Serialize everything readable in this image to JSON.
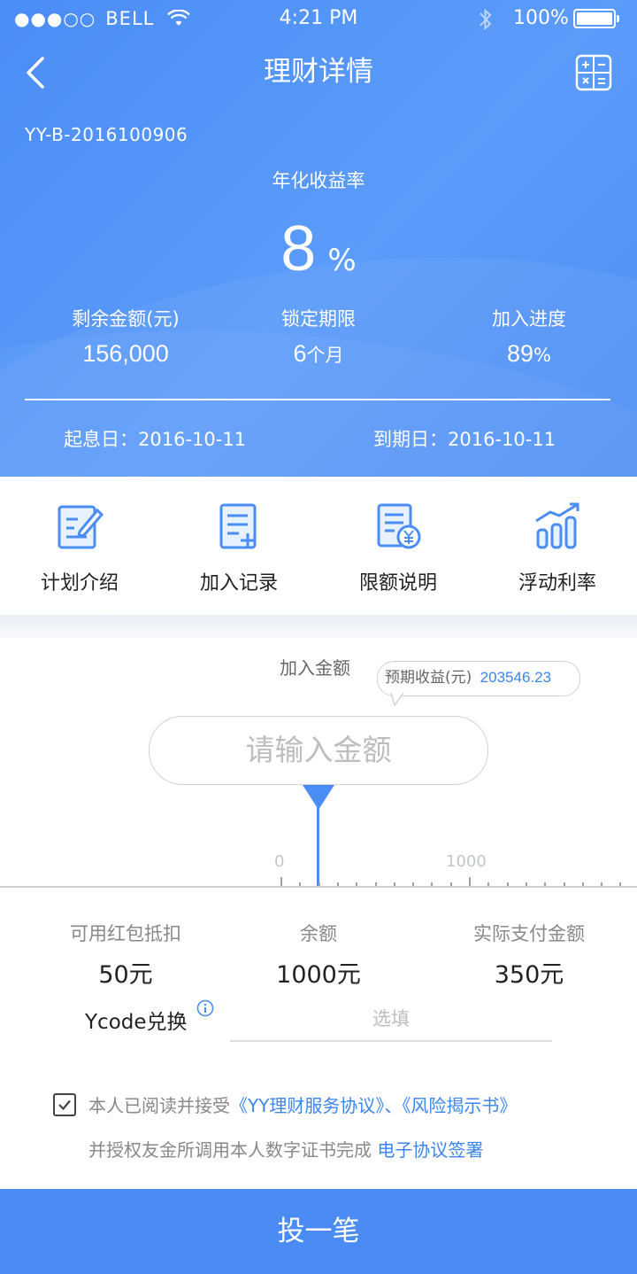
{
  "status_bar": {
    "carrier": "BELL",
    "time": "4:21 PM",
    "battery": "100%"
  },
  "nav": {
    "title": "理财详情",
    "back_icon": "chevron-left-icon",
    "calc_icon": "calculator-icon"
  },
  "product": {
    "code": "YY-B-2016100906",
    "rate_label": "年化收益率",
    "rate_value": "8",
    "rate_unit": "%",
    "stats": [
      {
        "label": "剩余金额(元)",
        "value": "156,000",
        "unit": ""
      },
      {
        "label": "锁定期限",
        "value": "6",
        "unit": "个月"
      },
      {
        "label": "加入进度",
        "value": "89",
        "unit": "%"
      }
    ],
    "start_date": "起息日：2016-10-11",
    "end_date": "到期日：2016-10-11"
  },
  "menu": [
    {
      "label": "计划介绍",
      "icon": "edit-document-icon"
    },
    {
      "label": "加入记录",
      "icon": "add-record-icon"
    },
    {
      "label": "限额说明",
      "icon": "yen-document-icon"
    },
    {
      "label": "浮动利率",
      "icon": "bar-chart-trend-icon"
    }
  ],
  "invest": {
    "amount_label": "加入金额",
    "expected_label": "预期收益(元)",
    "expected_value": "203546.23",
    "amount_placeholder": "请输入金额",
    "ruler_labels": [
      "0",
      "1000"
    ]
  },
  "summary": [
    {
      "label": "可用红包抵扣",
      "value": "50元"
    },
    {
      "label": "余额",
      "value": "1000元"
    },
    {
      "label": "实际支付金额",
      "value": "350元"
    }
  ],
  "ycode": {
    "label": "Ycode兑换",
    "placeholder": "选填",
    "info_icon": "info-icon"
  },
  "agreement": {
    "text1": "本人已阅读并接受",
    "link1": "《YY理财服务协议》",
    "sep": "、",
    "link2": "《风险揭示书》",
    "text2": "并授权友金所调用本人数字证书完成",
    "link3": "电子协议签署",
    "checked": true
  },
  "submit_label": "投一笔",
  "colors": {
    "primary": "#4a8df5",
    "link": "#3d86f0",
    "button": "#4a8cf4"
  }
}
